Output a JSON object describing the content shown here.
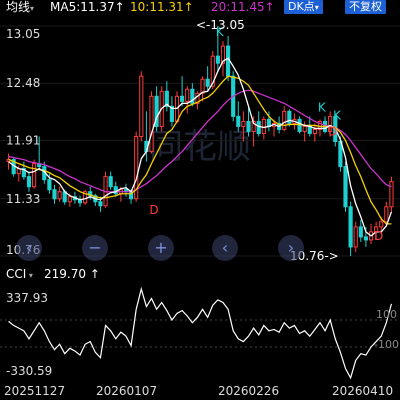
{
  "topbar": {
    "indicator_select": "均线",
    "ma5": "MA5:11.37",
    "ma10": "10:11.31",
    "ma20": "20:11.45",
    "arrow": "↑",
    "dk_button": "DK点",
    "rights_button": "不复权"
  },
  "colors": {
    "up": "#ff3b3b",
    "down": "#1fd0d0",
    "ma5": "#ffffff",
    "ma10": "#f5d000",
    "ma20": "#cc33cc",
    "accent": "#1d5fd4"
  },
  "watermark": "同花顺",
  "controls": [
    "chevron-left-icon",
    "minus-icon",
    "plus-icon",
    "chevron-left-icon",
    "chevron-right-icon"
  ],
  "cci": {
    "label": "CCI",
    "value": "219.70",
    "arrow": "↑",
    "top_label": "337.93",
    "bottom_label": "-330.59",
    "right_high": "100",
    "right_low": "-100"
  },
  "chart_data": {
    "type": "candlestick",
    "ylim": [
      10.76,
      13.05
    ],
    "y_ticks": [
      "13.05",
      "12.48",
      "11.91",
      "11.33",
      "10.76"
    ],
    "x_labels": [
      "20251127",
      "20260107",
      "20260226",
      "20260410"
    ],
    "annotations": [
      {
        "text": "<-13.05",
        "value": 13.05
      },
      {
        "text": "10.76->",
        "value": 10.76
      }
    ],
    "markers": [
      "K",
      "K",
      "D",
      "D",
      "K",
      "D"
    ],
    "candles": [
      [
        11.7,
        11.78,
        11.62,
        11.72
      ],
      [
        11.72,
        11.74,
        11.55,
        11.58
      ],
      [
        11.58,
        11.66,
        11.5,
        11.63
      ],
      [
        11.63,
        11.7,
        11.52,
        11.55
      ],
      [
        11.55,
        11.6,
        11.4,
        11.45
      ],
      [
        11.45,
        11.72,
        11.43,
        11.68
      ],
      [
        11.68,
        11.95,
        11.62,
        11.65
      ],
      [
        11.65,
        11.7,
        11.48,
        11.52
      ],
      [
        11.52,
        11.58,
        11.38,
        11.42
      ],
      [
        11.42,
        11.47,
        11.28,
        11.33
      ],
      [
        11.33,
        11.45,
        11.3,
        11.4
      ],
      [
        11.4,
        11.42,
        11.27,
        11.3
      ],
      [
        11.3,
        11.38,
        11.25,
        11.35
      ],
      [
        11.35,
        11.4,
        11.28,
        11.32
      ],
      [
        11.32,
        11.36,
        11.25,
        11.29
      ],
      [
        11.29,
        11.42,
        11.27,
        11.4
      ],
      [
        11.4,
        11.45,
        11.32,
        11.36
      ],
      [
        11.36,
        11.38,
        11.26,
        11.3
      ],
      [
        11.3,
        11.35,
        11.2,
        11.26
      ],
      [
        11.26,
        11.6,
        11.24,
        11.55
      ],
      [
        11.55,
        11.6,
        11.42,
        11.45
      ],
      [
        11.45,
        11.5,
        11.35,
        11.38
      ],
      [
        11.38,
        11.45,
        11.3,
        11.42
      ],
      [
        11.42,
        11.48,
        11.35,
        11.4
      ],
      [
        11.4,
        11.42,
        11.28,
        11.33
      ],
      [
        11.33,
        12.0,
        11.3,
        11.95
      ],
      [
        11.95,
        12.6,
        11.9,
        12.55
      ],
      [
        11.9,
        12.2,
        11.7,
        11.8
      ],
      [
        11.8,
        12.4,
        11.78,
        12.35
      ],
      [
        12.35,
        12.45,
        12.0,
        12.05
      ],
      [
        12.05,
        12.45,
        12.0,
        12.4
      ],
      [
        12.4,
        12.5,
        12.2,
        12.25
      ],
      [
        12.25,
        12.35,
        12.05,
        12.1
      ],
      [
        12.1,
        12.4,
        12.08,
        12.35
      ],
      [
        12.35,
        12.55,
        12.25,
        12.3
      ],
      [
        12.3,
        12.45,
        12.18,
        12.42
      ],
      [
        12.42,
        12.48,
        12.25,
        12.28
      ],
      [
        12.28,
        12.4,
        12.22,
        12.38
      ],
      [
        12.38,
        12.55,
        12.3,
        12.52
      ],
      [
        12.52,
        12.65,
        12.4,
        12.45
      ],
      [
        12.45,
        12.8,
        12.42,
        12.75
      ],
      [
        12.75,
        13.05,
        12.6,
        12.68
      ],
      [
        12.68,
        12.9,
        12.55,
        12.85
      ],
      [
        12.85,
        12.95,
        12.5,
        12.55
      ],
      [
        12.55,
        12.6,
        12.1,
        12.15
      ],
      [
        12.15,
        12.3,
        12.0,
        12.05
      ],
      [
        12.05,
        12.2,
        11.9,
        12.1
      ],
      [
        12.1,
        12.25,
        11.95,
        12.0
      ],
      [
        12.0,
        12.15,
        11.85,
        12.1
      ],
      [
        12.1,
        12.2,
        11.95,
        11.98
      ],
      [
        11.98,
        12.15,
        11.92,
        12.12
      ],
      [
        12.12,
        12.2,
        12.0,
        12.05
      ],
      [
        12.05,
        12.12,
        11.95,
        12.08
      ],
      [
        12.08,
        12.15,
        11.98,
        12.02
      ],
      [
        12.02,
        12.25,
        12.0,
        12.2
      ],
      [
        12.2,
        12.22,
        12.05,
        12.08
      ],
      [
        12.08,
        12.18,
        12.02,
        12.12
      ],
      [
        12.12,
        12.15,
        11.98,
        12.0
      ],
      [
        12.0,
        12.1,
        11.9,
        12.05
      ],
      [
        12.05,
        12.15,
        11.95,
        11.98
      ],
      [
        11.98,
        12.08,
        11.9,
        12.02
      ],
      [
        12.02,
        12.12,
        11.95,
        12.1
      ],
      [
        12.1,
        12.15,
        11.98,
        12.0
      ],
      [
        12.0,
        12.2,
        11.95,
        12.15
      ],
      [
        12.15,
        12.18,
        11.85,
        11.9
      ],
      [
        11.9,
        11.95,
        11.6,
        11.65
      ],
      [
        11.65,
        11.7,
        11.2,
        11.25
      ],
      [
        11.25,
        11.3,
        10.76,
        10.85
      ],
      [
        10.85,
        11.1,
        10.8,
        11.05
      ],
      [
        11.05,
        11.12,
        10.9,
        10.95
      ],
      [
        10.95,
        11.05,
        10.85,
        10.92
      ],
      [
        10.92,
        11.08,
        10.88,
        11.0
      ],
      [
        11.0,
        11.1,
        10.92,
        11.05
      ],
      [
        11.05,
        11.15,
        10.98,
        11.1
      ],
      [
        11.1,
        11.3,
        11.05,
        11.25
      ],
      [
        11.25,
        11.55,
        11.2,
        11.5
      ]
    ],
    "ma5": [
      11.7,
      11.66,
      11.63,
      11.62,
      11.59,
      11.6,
      11.63,
      11.6,
      11.54,
      11.52,
      11.48,
      11.4,
      11.36,
      11.34,
      11.32,
      11.33,
      11.35,
      11.33,
      11.32,
      11.36,
      11.39,
      11.4,
      11.43,
      11.44,
      11.4,
      11.52,
      11.73,
      11.8,
      11.98,
      12.14,
      12.23,
      12.27,
      12.23,
      12.23,
      12.28,
      12.28,
      12.31,
      12.35,
      12.39,
      12.4,
      12.48,
      12.6,
      12.7,
      12.73,
      12.65,
      12.56,
      12.42,
      12.25,
      12.08,
      12.05,
      12.04,
      12.05,
      12.07,
      12.05,
      12.09,
      12.11,
      12.1,
      12.08,
      12.06,
      12.05,
      12.03,
      12.03,
      12.03,
      12.06,
      12.03,
      11.92,
      11.74,
      11.46,
      11.28,
      11.15,
      11.0,
      10.96,
      11.0,
      11.0,
      11.06,
      11.2
    ],
    "ma10": [
      11.72,
      11.7,
      11.68,
      11.66,
      11.64,
      11.63,
      11.62,
      11.61,
      11.59,
      11.56,
      11.54,
      11.5,
      11.46,
      11.43,
      11.4,
      11.38,
      11.37,
      11.35,
      11.34,
      11.34,
      11.35,
      11.36,
      11.38,
      11.38,
      11.38,
      11.42,
      11.5,
      11.57,
      11.68,
      11.78,
      11.88,
      11.98,
      12.02,
      12.1,
      12.2,
      12.25,
      12.27,
      12.29,
      12.32,
      12.34,
      12.38,
      12.44,
      12.5,
      12.55,
      12.54,
      12.53,
      12.5,
      12.46,
      12.38,
      12.3,
      12.22,
      12.15,
      12.1,
      12.07,
      12.06,
      12.07,
      12.07,
      12.07,
      12.06,
      12.06,
      12.06,
      12.05,
      12.05,
      12.05,
      12.04,
      11.99,
      11.91,
      11.79,
      11.66,
      11.55,
      11.42,
      11.3,
      11.22,
      11.13,
      11.08,
      11.08
    ],
    "ma20": [
      11.75,
      11.74,
      11.73,
      11.72,
      11.7,
      11.69,
      11.68,
      11.67,
      11.65,
      11.63,
      11.61,
      11.58,
      11.55,
      11.53,
      11.5,
      11.48,
      11.46,
      11.44,
      11.42,
      11.4,
      11.4,
      11.4,
      11.4,
      11.4,
      11.4,
      11.42,
      11.45,
      11.48,
      11.52,
      11.56,
      11.61,
      11.66,
      11.7,
      11.75,
      11.8,
      11.86,
      11.92,
      11.98,
      12.04,
      12.1,
      12.15,
      12.2,
      12.26,
      12.31,
      12.35,
      12.38,
      12.4,
      12.41,
      12.4,
      12.38,
      12.36,
      12.34,
      12.32,
      12.3,
      12.28,
      12.25,
      12.22,
      12.19,
      12.16,
      12.13,
      12.1,
      12.08,
      12.06,
      12.05,
      12.04,
      12.01,
      11.97,
      11.91,
      11.84,
      11.77,
      11.7,
      11.63,
      11.58,
      11.52,
      11.47,
      11.45
    ],
    "cci": [
      90,
      60,
      40,
      20,
      -40,
      20,
      80,
      20,
      -60,
      -120,
      -80,
      -150,
      -110,
      -130,
      -160,
      -80,
      -60,
      -140,
      -180,
      60,
      20,
      -40,
      10,
      -20,
      -90,
      180,
      330,
      200,
      260,
      180,
      230,
      170,
      100,
      150,
      170,
      130,
      80,
      120,
      180,
      120,
      210,
      250,
      230,
      180,
      20,
      -40,
      -60,
      -20,
      40,
      -10,
      60,
      20,
      30,
      10,
      80,
      40,
      60,
      0,
      20,
      -20,
      30,
      80,
      20,
      100,
      -40,
      -140,
      -260,
      -330,
      -200,
      -150,
      -160,
      -100,
      -60,
      -20,
      80,
      220
    ]
  }
}
